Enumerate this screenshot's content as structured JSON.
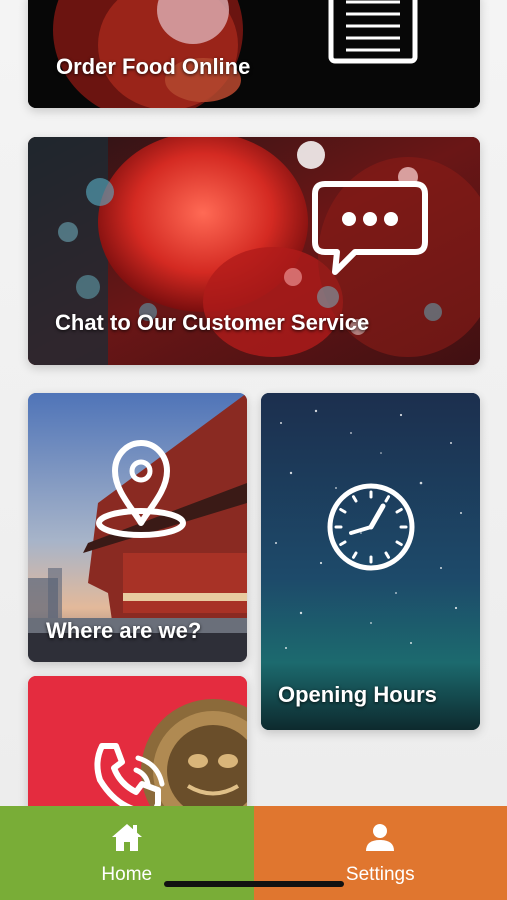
{
  "cards": {
    "order_food": {
      "label": "Order Food Online",
      "icon": "menu-icon"
    },
    "chat": {
      "label": "Chat to Our Customer Service",
      "icon": "chat-bubble-icon"
    },
    "where": {
      "label": "Where are we?",
      "icon": "location-pin-icon"
    },
    "hours": {
      "label": "Opening Hours",
      "icon": "clock-icon"
    },
    "call": {
      "label": "",
      "icon": "phone-icon"
    }
  },
  "tabbar": {
    "home": {
      "label": "Home",
      "icon": "home-icon",
      "color": "#79ad37"
    },
    "settings": {
      "label": "Settings",
      "icon": "user-icon",
      "color": "#e0762f"
    }
  }
}
